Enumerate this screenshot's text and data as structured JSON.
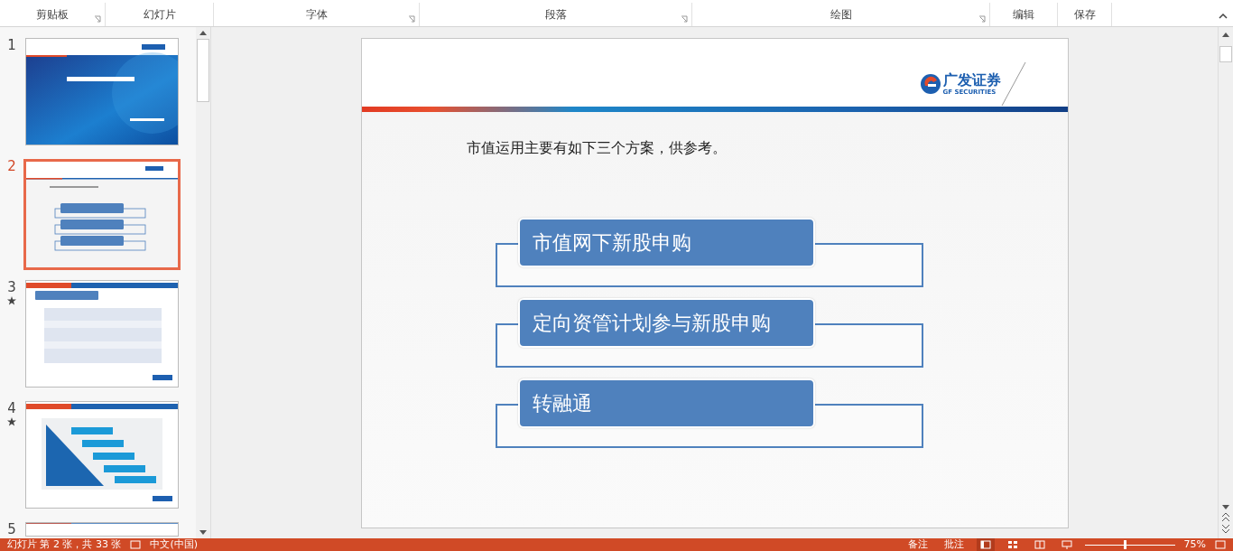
{
  "ribbon": {
    "groups": [
      {
        "label": "剪贴板",
        "launcher": true
      },
      {
        "label": "幻灯片",
        "launcher": false
      },
      {
        "label": "字体",
        "launcher": true
      },
      {
        "label": "段落",
        "launcher": true
      },
      {
        "label": "绘图",
        "launcher": true
      },
      {
        "label": "编辑",
        "launcher": false
      },
      {
        "label": "保存",
        "launcher": false
      }
    ]
  },
  "thumbnails": [
    {
      "number": "1",
      "selected": false,
      "starred": false,
      "kind": "title"
    },
    {
      "number": "2",
      "selected": true,
      "starred": false,
      "kind": "list"
    },
    {
      "number": "3",
      "selected": false,
      "starred": true,
      "kind": "table"
    },
    {
      "number": "4",
      "selected": false,
      "starred": true,
      "kind": "triangle"
    },
    {
      "number": "5",
      "selected": false,
      "starred": false,
      "kind": "partial"
    }
  ],
  "slide": {
    "logo": {
      "name": "广发证券",
      "subtitle": "GF SECURITIES"
    },
    "intro": "市值运用主要有如下三个方案，供参考。",
    "items": [
      "市值网下新股申购",
      "定向资管计划参与新股申购",
      "转融通"
    ]
  },
  "status_bar": {
    "slide_info": "幻灯片 第 2 张，共 33 张",
    "language": "中文(中国)",
    "notes": "备注",
    "comments": "批注",
    "zoom": "75%",
    "zoom_slider": {
      "level": 0.45
    }
  }
}
